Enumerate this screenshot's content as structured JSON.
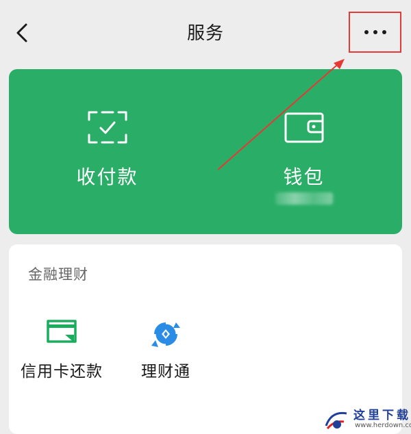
{
  "header": {
    "title": "服务"
  },
  "wallet_card": {
    "tiles": [
      {
        "label": "收付款",
        "icon": "scan-pay-icon"
      },
      {
        "label": "钱包",
        "icon": "wallet-icon"
      }
    ]
  },
  "finance_section": {
    "title": "金融理财",
    "items": [
      {
        "label": "信用卡还款",
        "icon": "credit-card-icon"
      },
      {
        "label": "理财通",
        "icon": "licaitong-icon"
      }
    ]
  },
  "annotation": {
    "highlight_color": "#e53935",
    "target": "more-button"
  },
  "watermark": {
    "title": "这里下载",
    "url": "www.herdown.com"
  },
  "colors": {
    "wallet_green": "#2aae67",
    "background": "#ededed",
    "icon_green": "#1aad5e",
    "icon_blue": "#2b8ce6"
  }
}
